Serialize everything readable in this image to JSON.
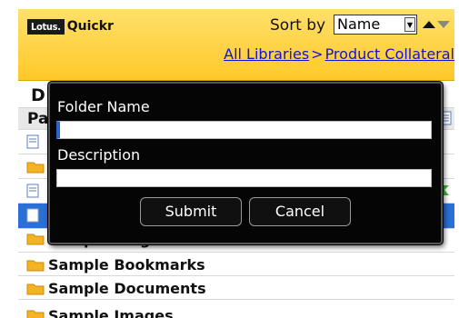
{
  "app": {
    "brand_badge": "Lotus.",
    "brand_name": "Quickr"
  },
  "header": {
    "sort_label": "Sort by",
    "sort_value": "Name",
    "breadcrumb": [
      {
        "label": "All Libraries"
      },
      {
        "label": "Product Collateral"
      }
    ],
    "breadcrumb_sep": ">"
  },
  "list": {
    "heading_partial": "D",
    "column_partial": "Pa",
    "items": [
      {
        "label": "Sample Blog Entries",
        "icon": "folder-icon"
      },
      {
        "label": "Sample Bookmarks",
        "icon": "folder-icon"
      },
      {
        "label": "Sample Documents",
        "icon": "folder-icon"
      },
      {
        "label": "Sample Images",
        "icon": "folder-icon"
      }
    ]
  },
  "dialog": {
    "folder_name_label": "Folder Name",
    "folder_name_value": "",
    "description_label": "Description",
    "description_value": "",
    "submit_label": "Submit",
    "cancel_label": "Cancel"
  },
  "colors": {
    "header": "#ffc829",
    "link": "#1212d6",
    "selection": "#2a6fd6",
    "dialog_bg": "#050505"
  }
}
